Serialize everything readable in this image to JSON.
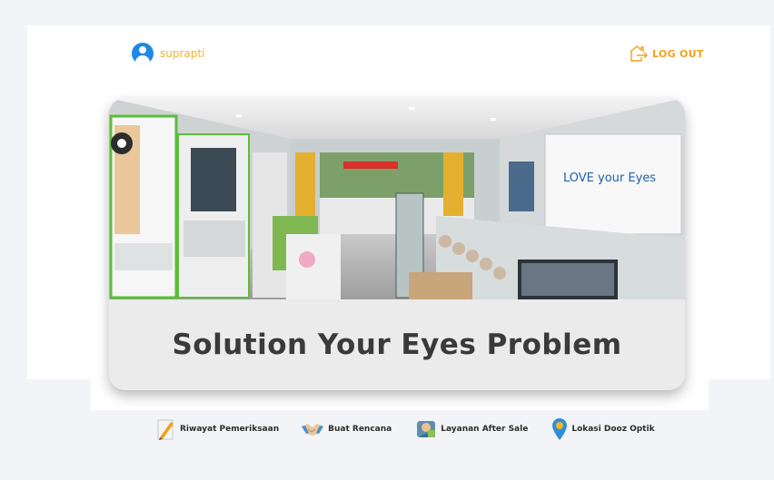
{
  "header": {
    "user_name": "suprapti",
    "logout_label": "LOG OUT"
  },
  "hero": {
    "sign_text": "LOVE your Eyes",
    "title": "Solution Your Eyes Problem"
  },
  "menu": {
    "items": [
      {
        "label": "Riwayat Pemeriksaan",
        "icon": "document-pen-icon"
      },
      {
        "label": "Buat Rencana",
        "icon": "handshake-icon"
      },
      {
        "label": "Layanan After Sale",
        "icon": "service-icon"
      },
      {
        "label": "Lokasi Dooz Optik",
        "icon": "location-pin-icon"
      }
    ]
  },
  "colors": {
    "accent": "#f0a21c",
    "avatar": "#1e88e5",
    "background": "#f3f4f7"
  }
}
